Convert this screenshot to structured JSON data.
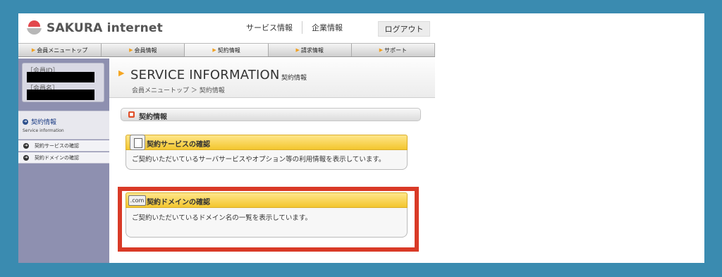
{
  "brand": {
    "name": "SAKURA internet"
  },
  "top_nav": {
    "service_info": "サービス情報",
    "company_info": "企業情報",
    "logout": "ログアウト"
  },
  "tabs": [
    {
      "label": "会員メニュートップ"
    },
    {
      "label": "会員情報"
    },
    {
      "label": "契約情報"
    },
    {
      "label": "請求情報"
    },
    {
      "label": "サポート"
    }
  ],
  "member": {
    "id_label": "［会員ID］",
    "name_label": "［会員名］"
  },
  "sidebar": {
    "heading": "契約情報",
    "heading_en": "Service information",
    "items": [
      {
        "label": "契約サービスの確認"
      },
      {
        "label": "契約ドメインの確認"
      }
    ]
  },
  "main": {
    "title": "SERVICE INFORMATION",
    "title_sub": "契約情報",
    "breadcrumb": "会員メニュートップ ＞ 契約情報",
    "section_title": "契約情報",
    "cards": [
      {
        "title": "契約サービスの確認",
        "body": "ご契約いただいているサーバサービスやオプション等の利用情報を表示しています。"
      },
      {
        "title": "契約ドメインの確認",
        "icon_text": ".com",
        "body": "ご契約いただいているドメイン名の一覧を表示しています。"
      }
    ]
  },
  "colors": {
    "background": "#3a8bb0",
    "accent": "#f3c62e",
    "highlight": "#d93a27",
    "sidebar": "#8e90b0"
  }
}
